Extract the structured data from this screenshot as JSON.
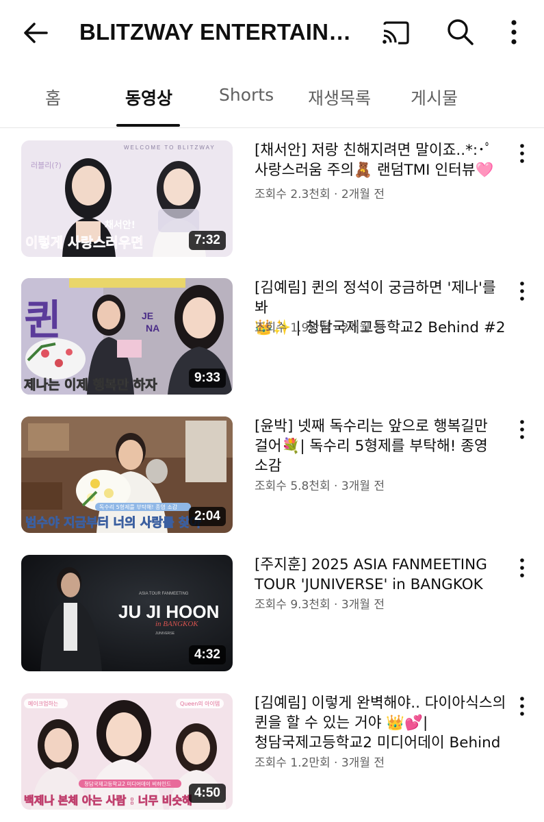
{
  "header": {
    "title": "BLITZWAY ENTERTAIN…",
    "icons": [
      "back-arrow-icon",
      "cast-icon",
      "search-icon",
      "more-vert-icon"
    ]
  },
  "tabs": [
    {
      "label": "홈",
      "active": false
    },
    {
      "label": "동영상",
      "active": true
    },
    {
      "label": "Shorts",
      "active": false
    },
    {
      "label": "재생목록",
      "active": false
    },
    {
      "label": "게시물",
      "active": false
    }
  ],
  "videos": [
    {
      "title": "[채서안] 저랑 친해지려면 말이죠..*:･ﾟ\n사랑스러움 주의🧸 랜덤TMI 인터뷰🩷",
      "views": "조회수 2.3천회",
      "age": "2개월 전",
      "meta": "조회수 2.3천회 · 2개월 전",
      "duration": "7:32",
      "thumb_text": "이렇게 사랑스러우면",
      "thumb_caption_top": "WELCOME TO BLITZWAY"
    },
    {
      "title": "[김예림] 퀸의 정석이 궁금하면 '제나'를 봐\n👑✨ | 청담국제고등학교2 Behind #2",
      "views": "조회수 1.9만회",
      "age": "2개월 전",
      "meta": "조회수 1.9만회 · 2개월 전",
      "duration": "9:33",
      "thumb_text": "제나는 이제 행복만 하자",
      "thumb_caption_top": "퀸"
    },
    {
      "title": "[윤박] 넷째 독수리는 앞으로 행복길만\n걸어💐| 독수리 5형제를 부탁해! 종영\n소감",
      "views": "조회수 5.8천회",
      "age": "3개월 전",
      "meta": "조회수 5.8천회 · 3개월 전",
      "duration": "2:04",
      "thumb_text": "범수야 지금부터 너의 사랑를 찾아",
      "thumb_caption_top": ""
    },
    {
      "title": "[주지훈] 2025 ASIA FANMEETING\nTOUR 'JUNIVERSE' in BANGKOK",
      "views": "조회수 9.3천회",
      "age": "3개월 전",
      "meta": "조회수 9.3천회 · 3개월 전",
      "duration": "4:32",
      "thumb_text": "JU JI HOON",
      "thumb_caption_top": "in BANGKOK"
    },
    {
      "title": "[김예림] 이렇게 완벽해야.. 다이아식스의\n퀸을 할 수 있는 거야 👑💕|\n청담국제고등학교2 미디어데이 Behind",
      "views": "조회수 1.2만회",
      "age": "3개월 전",
      "meta": "조회수 1.2만회 · 3개월 전",
      "duration": "4:50",
      "thumb_text": "백제나 본체 아는 사람 : 너무 비슷해",
      "thumb_caption_top": ""
    }
  ]
}
